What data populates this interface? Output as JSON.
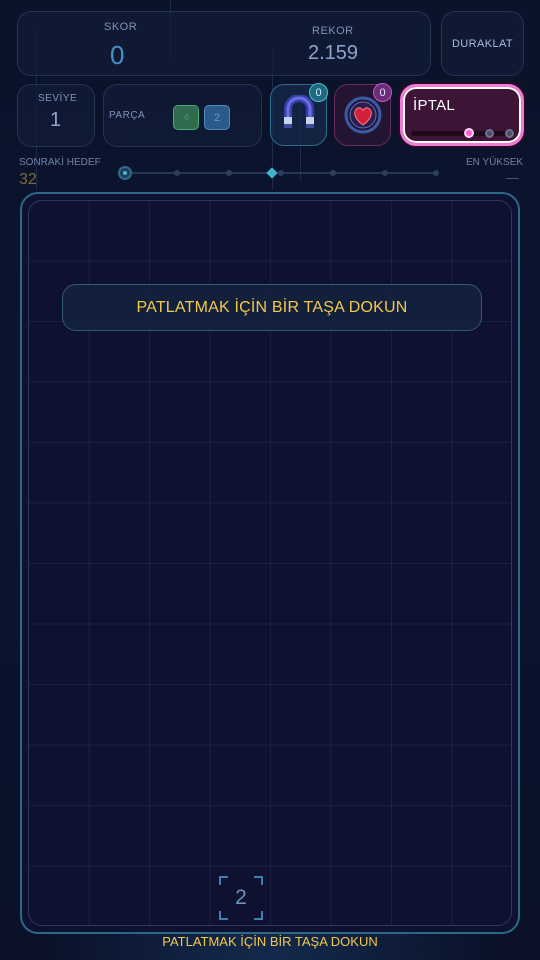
{
  "score": {
    "label": "SKOR",
    "value": "0"
  },
  "record": {
    "label": "REKOR",
    "value": "2.159"
  },
  "pause_button": {
    "label": "DURAKLAT"
  },
  "level": {
    "label": "SEVİYE",
    "value": "1"
  },
  "parts": {
    "label": "PARÇA",
    "tiles": [
      "4",
      "2"
    ]
  },
  "powerups": {
    "magnet": {
      "icon": "magnet-icon",
      "count": "0"
    },
    "heart": {
      "icon": "heart-icon",
      "count": "0"
    }
  },
  "cancel_button": {
    "label": "İPTAL"
  },
  "progress": {
    "next_target_label": "SONRAKİ HEDEF",
    "next_target_value": "32",
    "highest_label": "EN YÜKSEK",
    "highest_value": "—"
  },
  "board": {
    "hint": "PATLATMAK İÇİN BİR TAŞA DOKUN",
    "next_tile": "2"
  },
  "footer_hint": "PATLATMAK İÇİN BİR TAŞA DOKUN",
  "colors": {
    "accent_gold": "#f2c94a",
    "accent_cyan": "#3fb4d0",
    "accent_pink": "#f07ad6"
  }
}
